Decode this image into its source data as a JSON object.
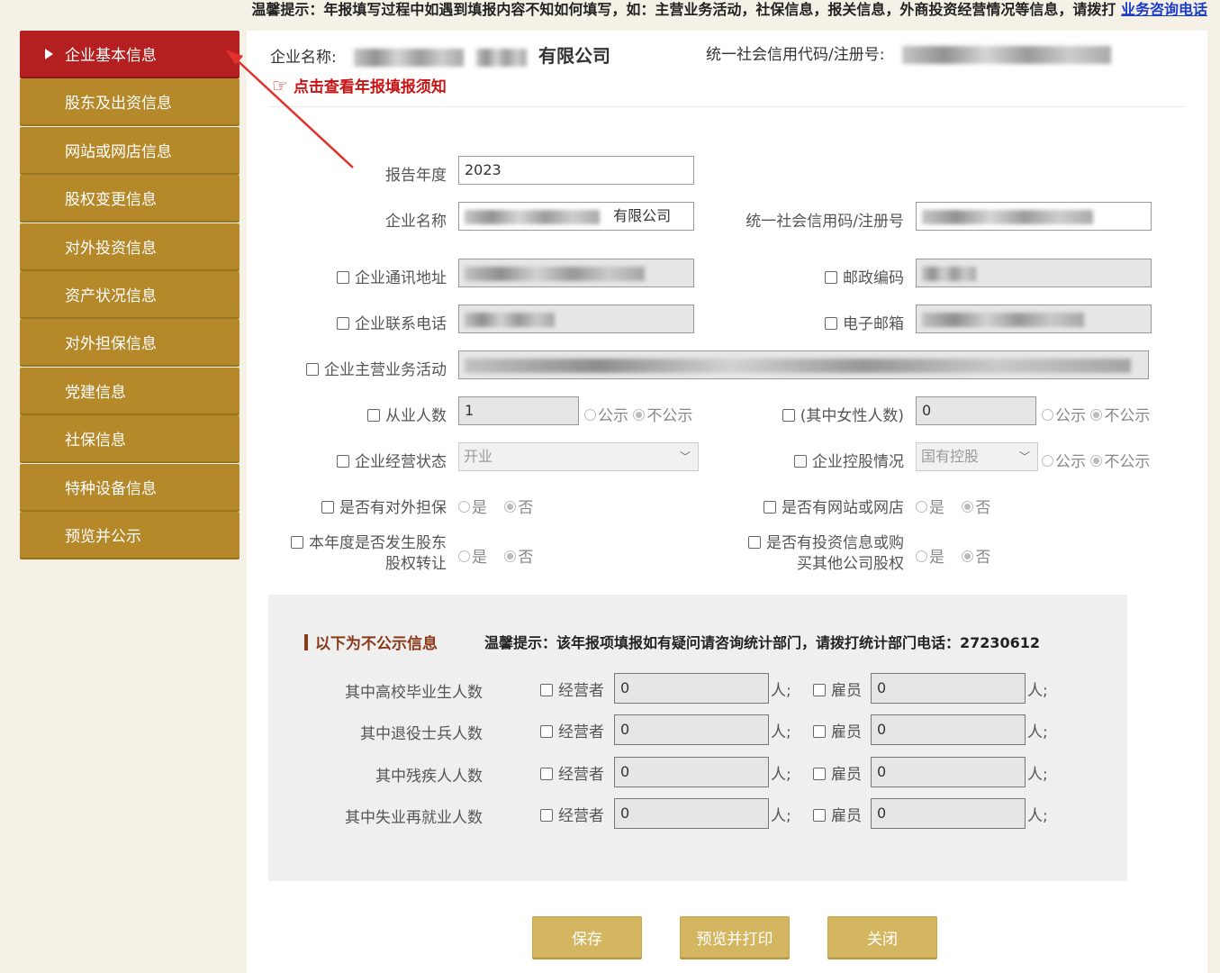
{
  "top_notice": {
    "text": "温馨提示：年报填写过程中如遇到填报内容不知如何填写，如：主营业务活动，社保信息，报关信息，外商投资经营情况等信息，请拨打 ",
    "link": "业务咨询电话"
  },
  "sidebar": {
    "items": [
      {
        "label": "企业基本信息",
        "active": true
      },
      {
        "label": "股东及出资信息"
      },
      {
        "label": "网站或网店信息"
      },
      {
        "label": "股权变更信息"
      },
      {
        "label": "对外投资信息"
      },
      {
        "label": "资产状况信息"
      },
      {
        "label": "对外担保信息"
      },
      {
        "label": "党建信息"
      },
      {
        "label": "社保信息"
      },
      {
        "label": "特种设备信息"
      },
      {
        "label": "预览并公示"
      }
    ]
  },
  "header": {
    "company_label": "企业名称:",
    "company_suffix": "有限公司",
    "credit_label": "统一社会信用代码/注册号:",
    "notice_link": "点击查看年报填报须知"
  },
  "form": {
    "report_year": {
      "label": "报告年度",
      "value": "2023"
    },
    "company_name": {
      "label": "企业名称",
      "value": "有限公司"
    },
    "credit_code": {
      "label": "统一社会信用码/注册号"
    },
    "address": {
      "label": "企业通讯地址"
    },
    "postal_code": {
      "label": "邮政编码"
    },
    "phone": {
      "label": "企业联系电话"
    },
    "email": {
      "label": "电子邮箱"
    },
    "main_business": {
      "label": "企业主营业务活动"
    },
    "employees": {
      "label": "从业人数",
      "value": "1"
    },
    "female_employees": {
      "label": "(其中女性人数)",
      "value": "0"
    },
    "public": "公示",
    "not_public": "不公示",
    "status": {
      "label": "企业经营状态",
      "value": "开业"
    },
    "holding": {
      "label": "企业控股情况",
      "value": "国有控股"
    },
    "yes": "是",
    "no": "否",
    "guarantee": {
      "label": "是否有对外担保"
    },
    "website": {
      "label": "是否有网站或网店"
    },
    "equity_transfer": {
      "label_line1": "本年度是否发生股东",
      "label_line2": "股权转让"
    },
    "investment": {
      "label_line1": "是否有投资信息或购",
      "label_line2": "买其他公司股权"
    }
  },
  "private": {
    "title": "以下为不公示信息",
    "tip": "温馨提示：该年报项填报如有疑问请咨询统计部门，请拨打统计部门电话：27230612",
    "operator": "经营者",
    "employee": "雇员",
    "unit": "人;",
    "rows": [
      {
        "label": "其中高校毕业生人数",
        "operator_value": "0",
        "employee_value": "0"
      },
      {
        "label": "其中退役士兵人数",
        "operator_value": "0",
        "employee_value": "0"
      },
      {
        "label": "其中残疾人人数",
        "operator_value": "0",
        "employee_value": "0"
      },
      {
        "label": "其中失业再就业人数",
        "operator_value": "0",
        "employee_value": "0"
      }
    ]
  },
  "buttons": {
    "save": "保存",
    "preview_print": "预览并打印",
    "close": "关闭"
  },
  "colors": {
    "sidebar": "#b5892a",
    "sidebar_active": "#b41f1f",
    "button": "#d4b661",
    "accent_red": "#c81414"
  }
}
